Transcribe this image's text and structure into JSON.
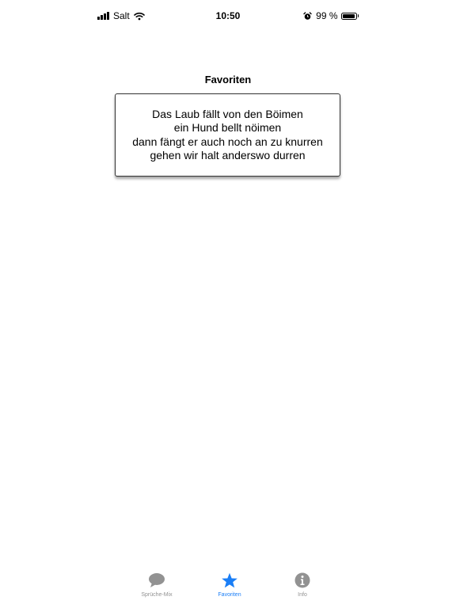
{
  "status_bar": {
    "carrier": "Salt",
    "time": "10:50",
    "battery_percent": "99 %",
    "battery_level": 0.99,
    "icons": [
      "signal-bars-icon",
      "wifi-icon",
      "alarm-clock-icon",
      "battery-icon"
    ]
  },
  "page": {
    "title": "Favoriten"
  },
  "favorite_card": {
    "lines": [
      "Das Laub fällt von den Böimen",
      "ein Hund bellt nöimen",
      "dann fängt er auch noch an zu knurren",
      "gehen wir halt anderswo durren"
    ]
  },
  "tab_bar": {
    "tabs": [
      {
        "label": "Sprüche-Mix",
        "icon": "speech-bubble-icon",
        "active": false
      },
      {
        "label": "Favoriten",
        "icon": "star-icon",
        "active": true
      },
      {
        "label": "Info",
        "icon": "info-circle-icon",
        "active": false
      }
    ]
  },
  "colors": {
    "accent": "#1a7ef6",
    "inactive": "#929292"
  }
}
